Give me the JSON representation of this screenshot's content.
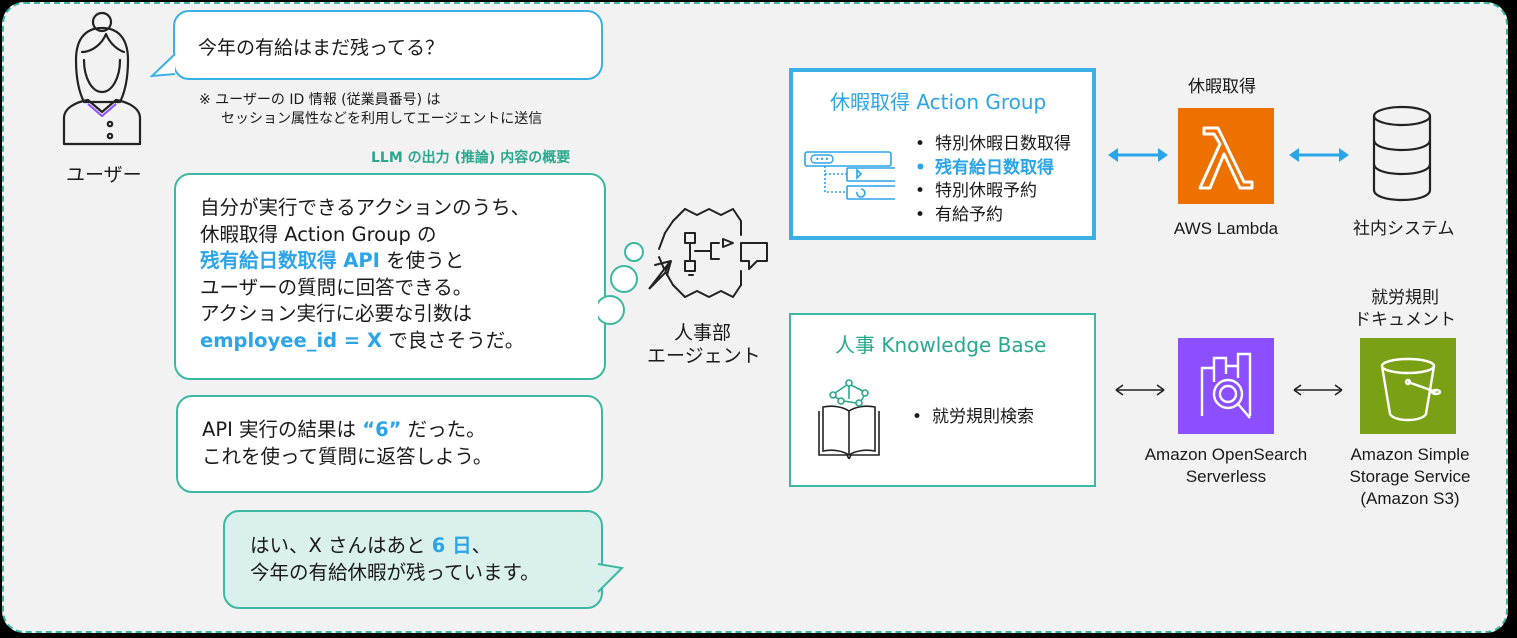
{
  "user": {
    "label": "ユーザー",
    "question": "今年の有給はまだ残ってる？",
    "note_line1": "※ ユーザーの ID 情報 (従業員番号) は",
    "note_line2": "セッション属性などを利用してエージェントに送信"
  },
  "llm_output": {
    "title": "LLM の出力 (推論) 内容の概要",
    "lines": {
      "l1": "自分が実行できるアクションのうち、",
      "l2": "休暇取得 Action Group の",
      "l3_hl": "残有給日数取得 API",
      "l3_rest": " を使うと",
      "l4": "ユーザーの質問に回答できる。",
      "l5": "アクション実行に必要な引数は",
      "l6_hl": "employee_id = X",
      "l6_rest": " で良さそうだ。"
    }
  },
  "api_result": {
    "pre": "API 実行の結果は ",
    "value": "“6”",
    "post": " だった。",
    "line2": "これを使って質問に返答しよう。"
  },
  "answer": {
    "pre": "はい、X さんはあと ",
    "value": "6 日",
    "post": "、",
    "line2": "今年の有給休暇が残っています。"
  },
  "agent": {
    "line1": "人事部",
    "line2": "エージェント"
  },
  "action_group": {
    "title": "休暇取得 Action Group",
    "items": [
      "特別休暇日数取得",
      "残有給日数取得",
      "特別休暇予約",
      "有給予約"
    ],
    "highlighted_index": 1
  },
  "knowledge_base": {
    "title": "人事 Knowledge Base",
    "items": [
      "就労規則検索"
    ]
  },
  "services": {
    "lambda_top": "休暇取得",
    "lambda": "AWS Lambda",
    "internal": "社内システム",
    "opensearch_l1": "Amazon OpenSearch",
    "opensearch_l2": "Serverless",
    "s3_top_l1": "就労規則",
    "s3_top_l2": "ドキュメント",
    "s3_l1": "Amazon Simple",
    "s3_l2": "Storage Service",
    "s3_l3": "(Amazon S3)"
  },
  "colors": {
    "teal": "#3cb8a2",
    "blue": "#2ba4e8",
    "lambda_orange": "#ed7100",
    "opensearch_purple": "#8c4fff",
    "s3_green": "#7aa116"
  }
}
